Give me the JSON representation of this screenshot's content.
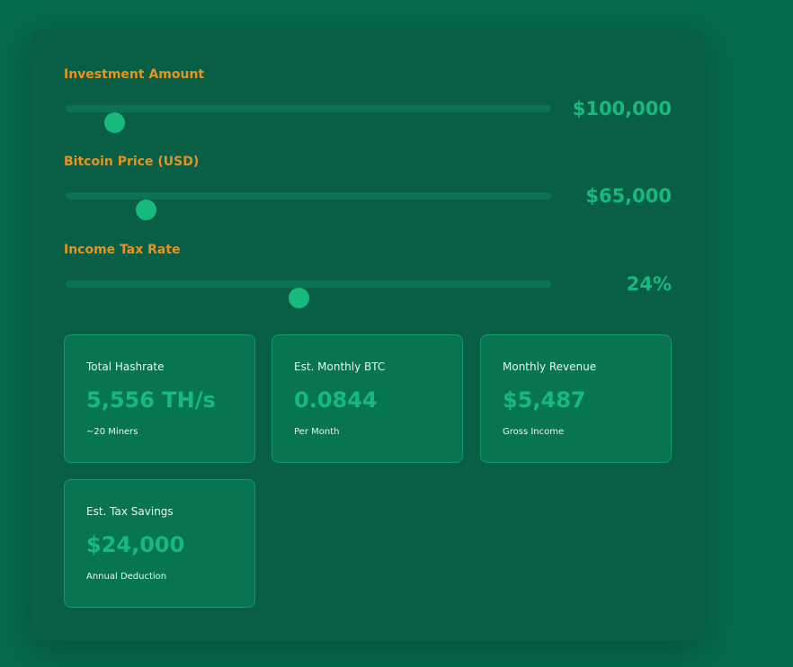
{
  "sliders": [
    {
      "label": "Investment Amount",
      "value": "$100,000",
      "level": 0.1
    },
    {
      "label": "Bitcoin Price (USD)",
      "value": "$65,000",
      "level": 0.165
    },
    {
      "label": "Income Tax Rate",
      "value": "24%",
      "level": 0.48
    }
  ],
  "stats": [
    {
      "title": "Total Hashrate",
      "value": "5,556 TH/s",
      "sub": "~20 Miners"
    },
    {
      "title": "Est. Monthly BTC",
      "value": "0.0844",
      "sub": "Per Month"
    },
    {
      "title": "Monthly Revenue",
      "value": "$5,487",
      "sub": "Gross Income"
    },
    {
      "title": "Est. Tax Savings",
      "value": "$24,000",
      "sub": "Annual Deduction"
    }
  ],
  "colors": {
    "accent": "#18b97c",
    "label": "#e8931f",
    "background": "#066a4c"
  }
}
